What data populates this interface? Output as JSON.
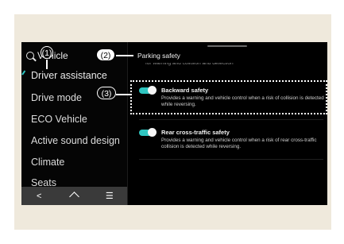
{
  "menu": {
    "header": "Vehicle",
    "items": [
      {
        "label": "Driver assistance",
        "active": true
      },
      {
        "label": "Drive mode"
      },
      {
        "label": "ECO Vehicle"
      },
      {
        "label": "Active sound design"
      },
      {
        "label": "Climate"
      },
      {
        "label": "Seats"
      }
    ]
  },
  "navbar": {
    "back": "<",
    "menu": "☰"
  },
  "panel": {
    "title": "Parking safety",
    "cutoff_text": "for warning and collision and detection",
    "settings": [
      {
        "title": "Backward safety",
        "desc": "Provides a warning and vehicle control when a risk of collision is detected while reversing.",
        "on": true
      },
      {
        "title": "Rear cross-traffic safety",
        "desc": "Provides a warning and vehicle control when a risk of rear cross-traffic collision is detected while reversing.",
        "on": true
      }
    ]
  },
  "annotations": [
    "(1)",
    "(2)",
    "(3)"
  ],
  "colors": {
    "accent": "#2fc5c0",
    "background": "#000000",
    "frame": "#efe9dc"
  }
}
